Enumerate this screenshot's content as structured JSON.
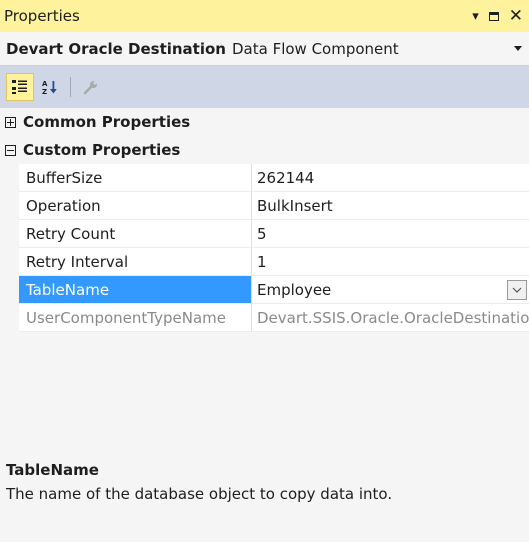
{
  "window": {
    "title": "Properties"
  },
  "object_selector": {
    "name": "Devart Oracle Destination",
    "type": "Data Flow Component"
  },
  "toolbar": {
    "categorized_icon": "categorized-icon",
    "alphabetical_icon": "sort-az-icon",
    "property_pages_icon": "wrench-icon"
  },
  "categories": [
    {
      "label": "Common Properties",
      "expanded": false
    },
    {
      "label": "Custom Properties",
      "expanded": true
    }
  ],
  "properties": [
    {
      "name": "BufferSize",
      "value": "262144"
    },
    {
      "name": "Operation",
      "value": "BulkInsert"
    },
    {
      "name": "Retry Count",
      "value": "5"
    },
    {
      "name": "Retry Interval",
      "value": "1"
    },
    {
      "name": "TableName",
      "value": "Employee",
      "selected": true
    },
    {
      "name": "UserComponentTypeName",
      "value": "Devart.SSIS.Oracle.OracleDestination",
      "readonly": true
    }
  ],
  "description": {
    "title": "TableName",
    "text": "The name of the database object to copy data into."
  },
  "colors": {
    "title_bar": "#fff29d",
    "toolbar": "#cfd6e5",
    "selection": "#3399ff"
  }
}
